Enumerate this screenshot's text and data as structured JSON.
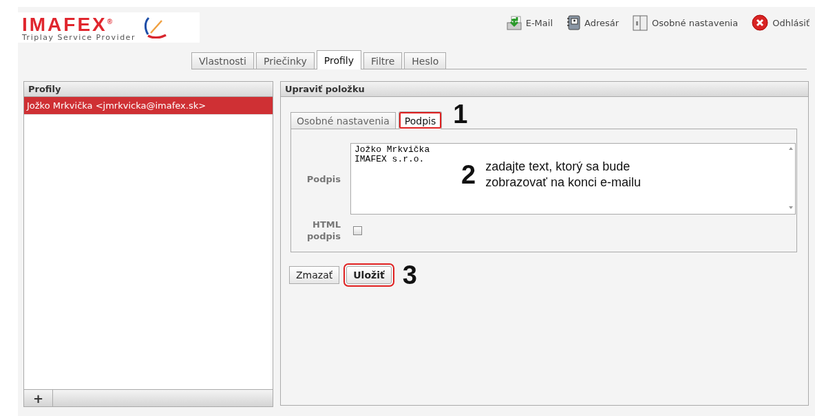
{
  "logo": {
    "name": "IMAFEX$^{®}$",
    "tagline": "Triplay Service Provider"
  },
  "top_links": [
    {
      "label": "E-Mail",
      "kind": "mail"
    },
    {
      "label": "Adresár",
      "kind": "contacts"
    },
    {
      "label": "Osobné nastavenia",
      "kind": "settings"
    },
    {
      "label": "Odhlásiť",
      "kind": "logout"
    }
  ],
  "tabs": [
    {
      "label": "Vlastnosti",
      "selected": false
    },
    {
      "label": "Priečinky",
      "selected": false
    },
    {
      "label": "Profily",
      "selected": true
    },
    {
      "label": "Filtre",
      "selected": false
    },
    {
      "label": "Heslo",
      "selected": false
    }
  ],
  "profiles_panel": {
    "title": "Profily",
    "items": [
      {
        "label": "Jožko Mrkvička <jmrkvicka@imafex.sk>",
        "selected": true
      }
    ],
    "add_button": "+"
  },
  "edit_panel": {
    "title": "Upraviť položku",
    "tabs": [
      {
        "label": "Osobné nastavenia",
        "selected": false,
        "highlighted": false
      },
      {
        "label": "Podpis",
        "selected": true,
        "highlighted": true
      }
    ],
    "tab_callout": "1",
    "signature": {
      "label": "Podpis",
      "value": "Jožko Mrkvička\nIMAFEX s.r.o."
    },
    "html_signature": {
      "label": "HTML podpis",
      "checked": false
    },
    "field_callout": {
      "number": "2",
      "text": "zadajte text, ktorý sa bude zobrazovať na konci e-mailu"
    },
    "buttons": [
      {
        "label": "Zmazať",
        "highlighted": false
      },
      {
        "label": "Uložiť",
        "highlighted": true
      }
    ],
    "button_callout": "3"
  }
}
